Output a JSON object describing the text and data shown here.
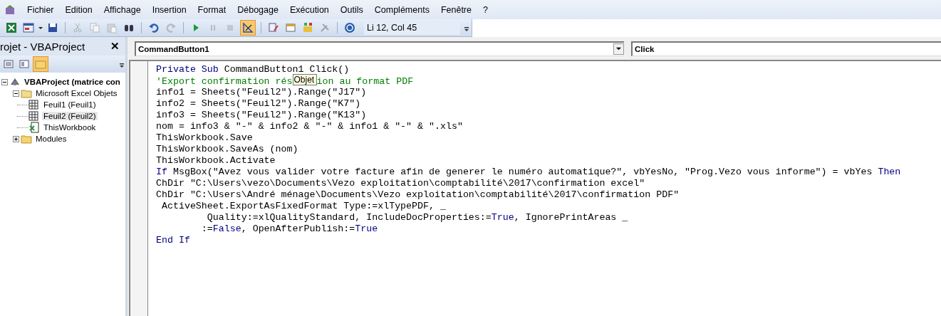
{
  "menu": [
    {
      "label": "Fichier"
    },
    {
      "label": "Edition"
    },
    {
      "label": "Affichage"
    },
    {
      "label": "Insertion"
    },
    {
      "label": "Format"
    },
    {
      "label": "Débogage"
    },
    {
      "label": "Exécution"
    },
    {
      "label": "Outils"
    },
    {
      "label": "Compléments"
    },
    {
      "label": "Fenêtre"
    },
    {
      "label": "?"
    }
  ],
  "toolbar": {
    "position": "Li 12, Col 45",
    "design_mode_on": true
  },
  "project": {
    "title": "rojet - VBAProject",
    "close": "✕",
    "tree": [
      {
        "label": "VBAProject (matrice con",
        "expanded": true,
        "selected": false,
        "children": [
          {
            "label": "Microsoft Excel Objets",
            "expanded": true,
            "selected": false,
            "children": [
              {
                "label": "Feuil1 (Feuil1)",
                "kind": "sheet",
                "selected": false
              },
              {
                "label": "Feuil2 (Feuil2)",
                "kind": "sheet",
                "selected": true
              },
              {
                "label": "ThisWorkbook",
                "kind": "workbook",
                "selected": false
              }
            ]
          },
          {
            "label": "Modules",
            "expanded": false,
            "selected": false
          }
        ]
      }
    ]
  },
  "editor": {
    "object": "CommandButton1",
    "procedure": "Click",
    "lines": [
      {
        "tokens": [
          {
            "kind": "keyword",
            "text": "Private Sub"
          },
          {
            "kind": "plain",
            "text": " CommandButton1 Click()"
          }
        ]
      },
      {
        "tokens": [
          {
            "kind": "comment",
            "text": "'Export confirmation rés"
          },
          {
            "kind": "tooltip",
            "text": "Objet"
          },
          {
            "kind": "comment",
            "text": "ion au format PDF"
          }
        ]
      },
      {
        "tokens": [
          {
            "kind": "plain",
            "text": "info1 = Sheets(\"Feuil2\").Range(\"J17\")"
          }
        ]
      },
      {
        "tokens": [
          {
            "kind": "plain",
            "text": "info2 = Sheets(\"Feuil2\").Range(\"K7\")"
          }
        ]
      },
      {
        "tokens": [
          {
            "kind": "plain",
            "text": "info3 = Sheets(\"Feuil2\").Range(\"K13\")"
          }
        ]
      },
      {
        "tokens": [
          {
            "kind": "plain",
            "text": "nom = info3 & \"-\" & info2 & \"-\" & info1 & \"-\" & \".xls\""
          }
        ]
      },
      {
        "tokens": [
          {
            "kind": "plain",
            "text": "ThisWorkbook.Save"
          }
        ]
      },
      {
        "tokens": [
          {
            "kind": "plain",
            "text": "ThisWorkbook.SaveAs (nom)"
          }
        ]
      },
      {
        "tokens": [
          {
            "kind": "plain",
            "text": "ThisWorkbook.Activate"
          }
        ]
      },
      {
        "tokens": [
          {
            "kind": "keyword",
            "text": "If"
          },
          {
            "kind": "plain",
            "text": " MsgBox(\"Avez vous valider votre facture afin de generer le numéro automatique?\", vbYesNo, \"Prog.Vezo vous informe\") = vbYes "
          },
          {
            "kind": "keyword",
            "text": "Then"
          }
        ]
      },
      {
        "tokens": [
          {
            "kind": "plain",
            "text": "ChDir \"C:\\Users\\vezo\\Documents\\Vezo exploitation\\comptabilité\\2017\\confirmation excel\""
          }
        ]
      },
      {
        "tokens": [
          {
            "kind": "plain",
            "text": "ChDir \"C:\\Users\\André ménage\\Documents\\Vezo exploitation\\comptabilité\\2017\\confirmation PDF\""
          }
        ]
      },
      {
        "tokens": [
          {
            "kind": "plain",
            "text": " ActiveSheet.ExportAsFixedFormat Type:=xlTypePDF, _"
          }
        ]
      },
      {
        "tokens": [
          {
            "kind": "plain",
            "text": "         Quality:=xlQualityStandard, IncludeDocProperties:="
          },
          {
            "kind": "keyword",
            "text": "True"
          },
          {
            "kind": "plain",
            "text": ", IgnorePrintAreas _"
          }
        ]
      },
      {
        "tokens": [
          {
            "kind": "plain",
            "text": "        :="
          },
          {
            "kind": "keyword",
            "text": "False"
          },
          {
            "kind": "plain",
            "text": ", OpenAfterPublish:="
          },
          {
            "kind": "keyword",
            "text": "True"
          }
        ]
      },
      {
        "tokens": [
          {
            "kind": "keyword",
            "text": "End If"
          }
        ]
      }
    ]
  }
}
